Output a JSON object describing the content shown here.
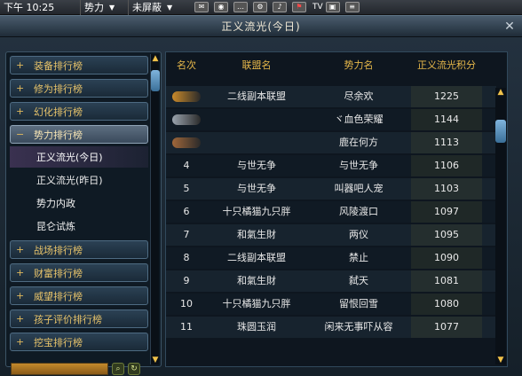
{
  "topbar": {
    "time": "下午 10:25",
    "faction": "势力",
    "mask": "未屏蔽",
    "tv": "TV"
  },
  "window": {
    "title": "正义流光(今日)"
  },
  "sidebar": {
    "categories_top": [
      "装备排行榜",
      "修为排行榜",
      "幻化排行榜"
    ],
    "active_category": "势力排行榜",
    "subitems": [
      "正义流光(今日)",
      "正义流光(昨日)",
      "势力内政",
      "昆仑试炼"
    ],
    "categories_bottom": [
      "战场排行榜",
      "财富排行榜",
      "威望排行榜",
      "孩子评价排行榜",
      "挖宝排行榜"
    ]
  },
  "table": {
    "headers": [
      "名次",
      "联盟名",
      "势力名",
      "正义流光积分"
    ],
    "rows": [
      {
        "rank": "",
        "alliance": "二线副本联盟",
        "faction": "尽余欢",
        "score": "1225"
      },
      {
        "rank": "",
        "alliance": "",
        "faction": "ヾ血色荣耀",
        "score": "1144"
      },
      {
        "rank": "",
        "alliance": "",
        "faction": "鹿在何方",
        "score": "1113"
      },
      {
        "rank": "4",
        "alliance": "与世无争",
        "faction": "与世无争",
        "score": "1106"
      },
      {
        "rank": "5",
        "alliance": "与世无争",
        "faction": "叫器吧人宠",
        "score": "1103"
      },
      {
        "rank": "6",
        "alliance": "十只橘猫九只胖",
        "faction": "风陵渡口",
        "score": "1097"
      },
      {
        "rank": "7",
        "alliance": "和氣生財",
        "faction": "两仪",
        "score": "1095"
      },
      {
        "rank": "8",
        "alliance": "二线副本联盟",
        "faction": "禁止",
        "score": "1090"
      },
      {
        "rank": "9",
        "alliance": "和氣生財",
        "faction": "弑天",
        "score": "1081"
      },
      {
        "rank": "10",
        "alliance": "十只橘猫九只胖",
        "faction": "留恨回雪",
        "score": "1080"
      },
      {
        "rank": "11",
        "alliance": "珠圆玉润",
        "faction": "闲来无事吓从容",
        "score": "1077"
      }
    ]
  },
  "colors": {
    "gold": "#e7b84a",
    "rank1": "#c98a2a",
    "rank2": "#9aa3ad",
    "rank3": "#a0673a"
  }
}
